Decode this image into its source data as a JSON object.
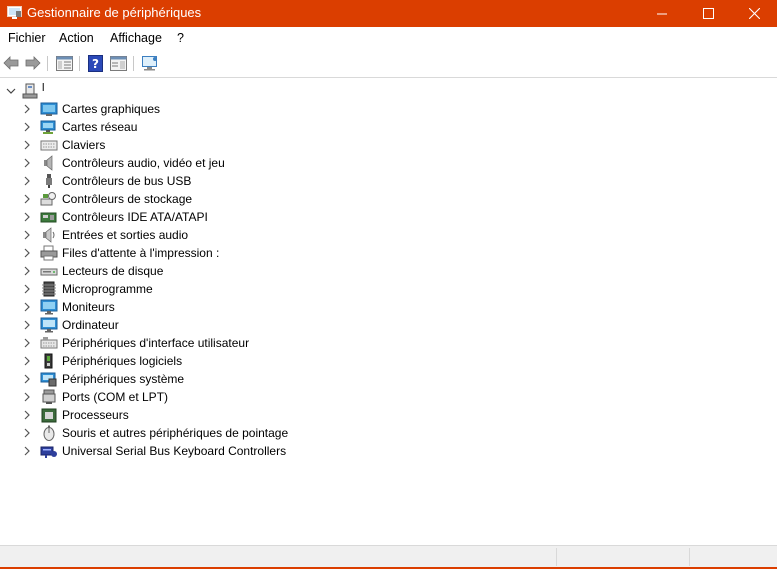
{
  "window": {
    "title": "Gestionnaire de périphériques",
    "accent_color": "#db3e00",
    "controls": [
      "minimize-icon",
      "maximize-icon",
      "close-icon"
    ]
  },
  "menu": [
    "Fichier",
    "Action",
    "Affichage",
    "?"
  ],
  "toolbar": [
    "back-arrow-icon",
    "forward-arrow-icon",
    "properties-icon",
    "help-icon",
    "action-pane-icon",
    "scan-hardware-icon"
  ],
  "tree": {
    "root_label": "l",
    "items": [
      {
        "label": "Cartes graphiques",
        "icon": "display-adapter-icon"
      },
      {
        "label": "Cartes réseau",
        "icon": "network-adapter-icon"
      },
      {
        "label": "Claviers",
        "icon": "keyboard-icon"
      },
      {
        "label": "Contrôleurs audio, vidéo et jeu",
        "icon": "speaker-icon"
      },
      {
        "label": "Contrôleurs de bus USB",
        "icon": "usb-icon"
      },
      {
        "label": "Contrôleurs de stockage",
        "icon": "storage-controller-icon"
      },
      {
        "label": "Contrôleurs IDE ATA/ATAPI",
        "icon": "ide-controller-icon"
      },
      {
        "label": "Entrées et sorties audio",
        "icon": "audio-io-icon"
      },
      {
        "label": "Files d'attente à l'impression :",
        "icon": "printer-icon"
      },
      {
        "label": "Lecteurs de disque",
        "icon": "disk-drive-icon"
      },
      {
        "label": "Microprogramme",
        "icon": "firmware-chip-icon"
      },
      {
        "label": "Moniteurs",
        "icon": "monitor-icon"
      },
      {
        "label": "Ordinateur",
        "icon": "computer-icon"
      },
      {
        "label": "Périphériques d'interface utilisateur",
        "icon": "hid-icon"
      },
      {
        "label": "Périphériques logiciels",
        "icon": "software-device-icon"
      },
      {
        "label": "Périphériques système",
        "icon": "system-device-icon"
      },
      {
        "label": "Ports (COM et LPT)",
        "icon": "port-icon"
      },
      {
        "label": "Processeurs",
        "icon": "processor-icon"
      },
      {
        "label": "Souris et autres périphériques de pointage",
        "icon": "mouse-icon"
      },
      {
        "label": "Universal Serial Bus Keyboard Controllers",
        "icon": "usb-keyboard-controller-icon"
      }
    ]
  }
}
